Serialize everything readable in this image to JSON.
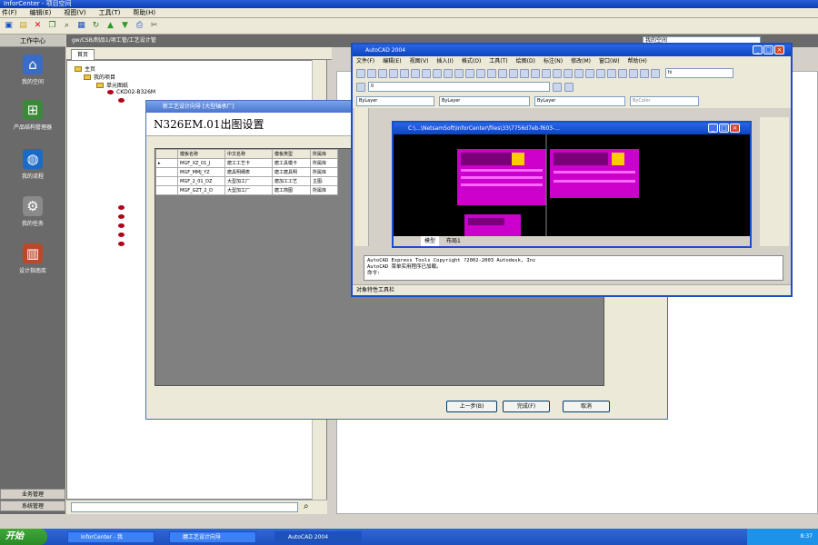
{
  "main_window": {
    "title": "InforCenter - 项目空间",
    "menu": [
      "件(F)",
      "编辑(E)",
      "视图(V)",
      "工具(T)",
      "帮助(H)"
    ],
    "toolbar_icons": [
      "new-icon",
      "open-icon",
      "delete-icon",
      "copy-icon",
      "search-icon",
      "filter-icon",
      "refresh-icon",
      "up-icon",
      "down-icon",
      "print-icon",
      "settings-icon"
    ],
    "path": "gw/CSB/制品1/项工管/工艺设计管",
    "right_combo": "我的空间"
  },
  "left_nav": {
    "title": "工作中心",
    "items": [
      {
        "label": "我的空间",
        "icon": "home-icon"
      },
      {
        "label": "产品结构管理器",
        "icon": "structure-icon"
      },
      {
        "label": "我的流程",
        "icon": "globe-icon"
      },
      {
        "label": "我的任务",
        "icon": "gears-icon"
      },
      {
        "label": "设计指南库",
        "icon": "book-icon"
      }
    ],
    "bottom": [
      "业务管理",
      "系统管理"
    ]
  },
  "tree": {
    "tab": "首页",
    "nodes": [
      "主页",
      "我的项目",
      "单元图纸",
      "CKD02-B326M"
    ]
  },
  "wizard": {
    "title": "新工艺设计向导 [大型轴承厂]",
    "header": "N326EM.01出图设置",
    "columns": [
      "模板名称",
      "中文名称",
      "模板类型",
      "所属库"
    ],
    "rows": [
      [
        "MGF_XZ_01_J",
        "磨工工艺卡",
        "磨工具模卡",
        "所属库"
      ],
      [
        "MGF_MMJ_YZ",
        "磨具明细表",
        "磨工磨具明",
        "所属库"
      ],
      [
        "MGF_2_01_DZ",
        "大型加工厂",
        "磨加工工艺",
        "主图:"
      ],
      [
        "MGF_GZT_2_D",
        "大型加工厂",
        "磨工简图",
        "所属库"
      ]
    ],
    "buttons": {
      "back": "上一步(B)",
      "finish": "完成(F)",
      "cancel": "取消"
    }
  },
  "autocad": {
    "title": "AutoCAD 2004",
    "menu": [
      "文件(F)",
      "编辑(E)",
      "视图(V)",
      "插入(I)",
      "格式(O)",
      "工具(T)",
      "绘图(D)",
      "标注(N)",
      "修改(M)",
      "窗口(W)",
      "帮助(H)"
    ],
    "layer_combo": "0",
    "linetype_combo": "ByLayer",
    "color_combo": "ByLayer",
    "lineweight_combo": "ByLayer",
    "plotstyle_combo": "ByColor",
    "search_combo": "hi",
    "drawing_title": "C:\\...\\NetsamSoft\\InforCenter\\files\\33\\7756d7eb-f603-...",
    "model_tab": "模型",
    "layout_tab": "布局1",
    "command_lines": [
      "AutoCAD Express Tools Copyright ?2002-2003 Autodesk, Inc",
      "AutoCAD 菜单实用程序已加载。",
      "命令:"
    ],
    "status": "对象特性工具栏"
  },
  "taskbar": {
    "start": "开始",
    "tasks": [
      "InforCenter - 我",
      "磨工艺设计向导",
      "AutoCAD 2004"
    ],
    "clock": "8:37"
  },
  "colors": {
    "accent": "#1a4fc8",
    "magenta": "#cc00cc",
    "nav_bg": "#6a6a6a"
  }
}
